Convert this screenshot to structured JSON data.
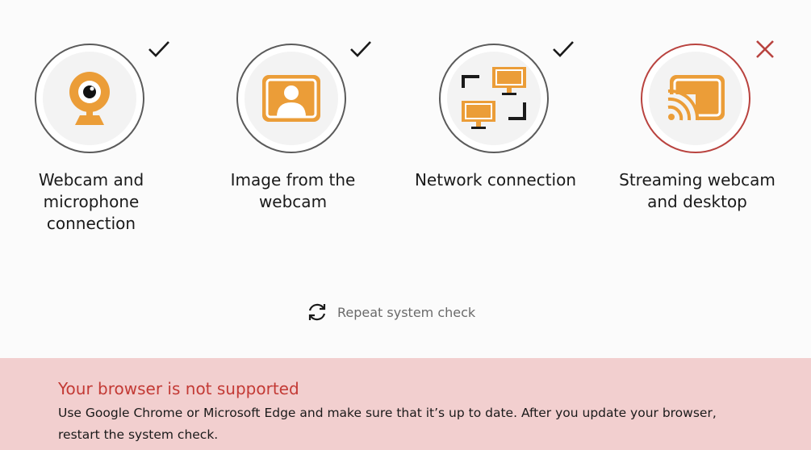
{
  "checks": [
    {
      "label": "Webcam and\nmicrophone\nconnection",
      "status": "ok",
      "icon": "webcam-icon"
    },
    {
      "label": "Image from the\nwebcam",
      "status": "ok",
      "icon": "user-image-icon"
    },
    {
      "label": "Network connection",
      "status": "ok",
      "icon": "network-icon"
    },
    {
      "label": "Streaming webcam\nand desktop",
      "status": "fail",
      "icon": "cast-icon"
    }
  ],
  "repeat": {
    "label": "Repeat system check",
    "icon": "refresh-icon"
  },
  "banner": {
    "title": "Your browser is not supported",
    "body": "Use Google Chrome or Microsoft Edge and make sure that it’s up to date. After you update your browser, restart the system check."
  },
  "colors": {
    "accent": "#eb9d38",
    "ok": "#1a1a1a",
    "fail": "#b9433f",
    "banner_bg": "#f2cfcf",
    "banner_title": "#c33a35"
  }
}
